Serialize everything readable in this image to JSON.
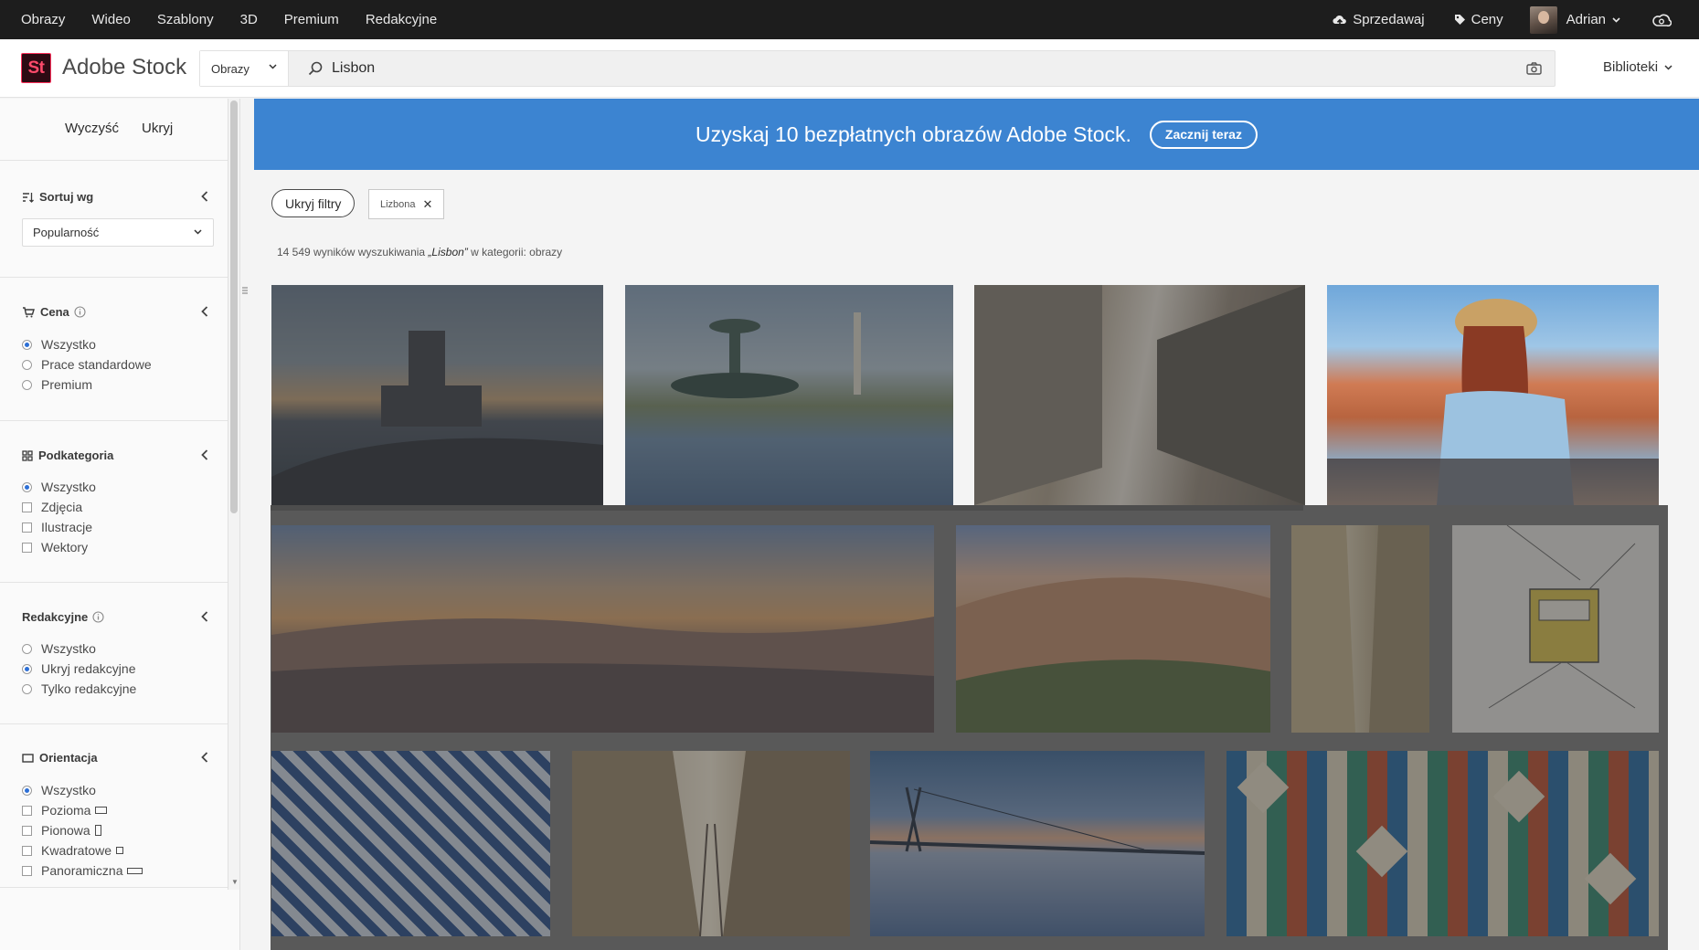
{
  "topnav": {
    "links": [
      "Obrazy",
      "Wideo",
      "Szablony",
      "3D",
      "Premium",
      "Redakcyjne"
    ],
    "sell": "Sprzedawaj",
    "pricing": "Ceny",
    "user": "Adrian"
  },
  "header": {
    "logo_mark": "St",
    "logo_text": "Adobe Stock",
    "search_type": "Obrazy",
    "search_value": "Lisbon",
    "libraries": "Biblioteki"
  },
  "sidebar": {
    "clear": "Wyczyść",
    "hide": "Ukryj",
    "sort": {
      "title": "Sortuj wg",
      "value": "Popularność"
    },
    "price": {
      "title": "Cena",
      "options": [
        "Wszystko",
        "Prace standardowe",
        "Premium"
      ],
      "selected": 0
    },
    "subcategory": {
      "title": "Podkategoria",
      "options": [
        "Wszystko",
        "Zdjęcia",
        "Ilustracje",
        "Wektory"
      ],
      "selected": 0
    },
    "editorial": {
      "title": "Redakcyjne",
      "options": [
        "Wszystko",
        "Ukryj redakcyjne",
        "Tylko redakcyjne"
      ],
      "selected": 1
    },
    "orientation": {
      "title": "Orientacja",
      "options": [
        "Wszystko",
        "Pozioma",
        "Pionowa",
        "Kwadratowe",
        "Panoramiczna"
      ],
      "selected": 0
    }
  },
  "banner": {
    "message": "Uzyskaj 10 bezpłatnych obrazów Adobe Stock.",
    "cta": "Zacznij teraz"
  },
  "filters": {
    "hide_filters": "Ukryj filtry",
    "chip": "Lizbona"
  },
  "results": {
    "count": "14 549",
    "prefix": "wyników wyszukiwania",
    "query": "„Lisbon”",
    "suffix": "w kategorii: obrazy"
  },
  "images": [
    {
      "subject": "Belem Tower at sunset"
    },
    {
      "subject": "Fountain at Rossio square"
    },
    {
      "subject": "Lisbon street with buildings"
    },
    {
      "subject": "Woman in hat overlooking Lisbon rooftops"
    },
    {
      "subject": "Lisbon panorama at dusk"
    },
    {
      "subject": "Castle hill with colorful houses"
    },
    {
      "subject": "Narrow Lisbon street"
    },
    {
      "subject": "Yellow tram sketch"
    },
    {
      "subject": "Blue azulejo tiles"
    },
    {
      "subject": "Alley with tram tracks"
    },
    {
      "subject": "Vasco da Gama bridge at sunrise"
    },
    {
      "subject": "Colorful Portuguese tiles"
    }
  ]
}
